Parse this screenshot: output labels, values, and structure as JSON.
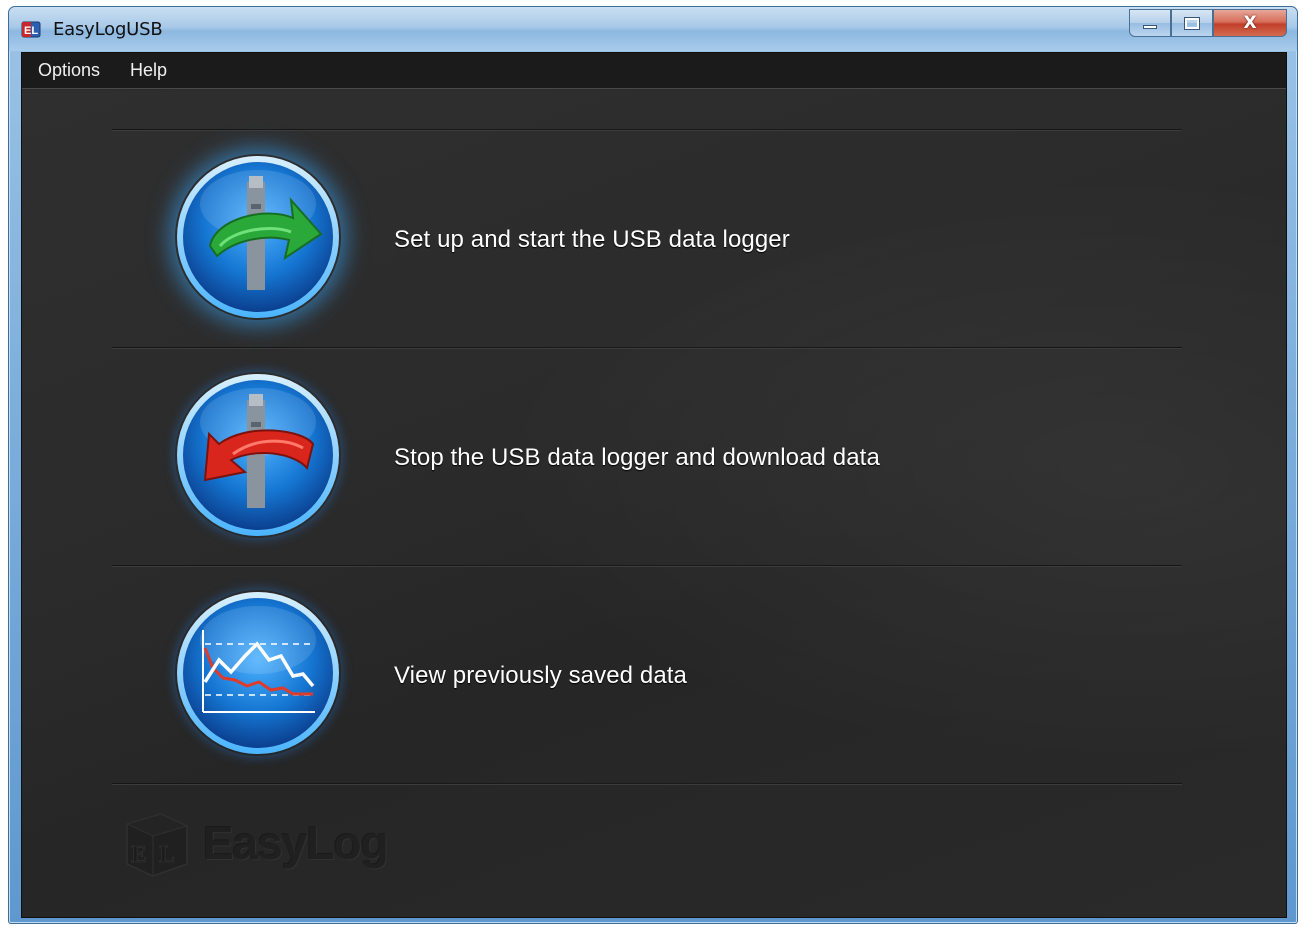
{
  "window": {
    "title": "EasyLogUSB",
    "controls": {
      "minimize": "minimize",
      "maximize": "maximize",
      "close": "X"
    }
  },
  "menu": {
    "items": [
      {
        "label": "Options"
      },
      {
        "label": "Help"
      }
    ]
  },
  "actions": [
    {
      "label": "Set up and start the USB data logger",
      "icon": "usb-green-arrow-icon"
    },
    {
      "label": "Stop the USB data logger and download data",
      "icon": "usb-red-arrow-icon"
    },
    {
      "label": "View previously saved data",
      "icon": "line-graph-icon"
    }
  ],
  "watermark": {
    "text": "EasyLog"
  },
  "colors": {
    "content_bg": "#2a2a2a",
    "menubar_bg": "#1b1b1b",
    "orb_blue": "#1a7fd6",
    "start_arrow": "#2aa83a",
    "stop_arrow": "#d8261c"
  }
}
